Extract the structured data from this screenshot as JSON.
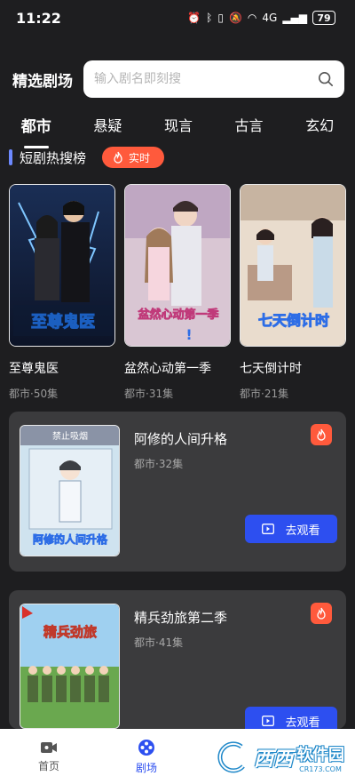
{
  "status_bar": {
    "time": "11:22",
    "signal_label": "4G",
    "battery": "79"
  },
  "header": {
    "title": "精选剧场",
    "search_placeholder": "输入剧名即刻搜"
  },
  "tabs": [
    "都市",
    "悬疑",
    "现言",
    "古言",
    "玄幻"
  ],
  "active_tab": "都市",
  "section": {
    "title": "短剧热搜榜",
    "badge": "实时"
  },
  "hot_dramas": [
    {
      "title": "至尊鬼医",
      "meta": "都市·50集",
      "poster_text": "至尊鬼医"
    },
    {
      "title": "盆然心动第一季",
      "meta": "都市·31集",
      "poster_text": "盆然心动第一季"
    },
    {
      "title": "七天倒计时",
      "meta": "都市·21集",
      "poster_text": "七天倒计时"
    }
  ],
  "list_dramas": [
    {
      "title": "阿修的人间升格",
      "meta": "都市·32集",
      "poster_text": "阿修的人间升格",
      "poster_top": "禁止吸烟",
      "button": "去观看"
    },
    {
      "title": "精兵劲旅第二季",
      "meta": "都市·41集",
      "poster_text": "精兵劲旅",
      "button": "去观看"
    }
  ],
  "bottom_nav": [
    {
      "label": "首页",
      "icon": "video-camera-icon",
      "active": false
    },
    {
      "label": "剧场",
      "icon": "film-reel-icon",
      "active": true
    }
  ],
  "watermark": {
    "main": "西西",
    "brand": "软件园",
    "domain": "CR173.COM"
  },
  "colors": {
    "accent": "#2d4ff0",
    "hot": "#ff5a3c",
    "background": "#1e1e20",
    "card": "#3b3b3d"
  }
}
